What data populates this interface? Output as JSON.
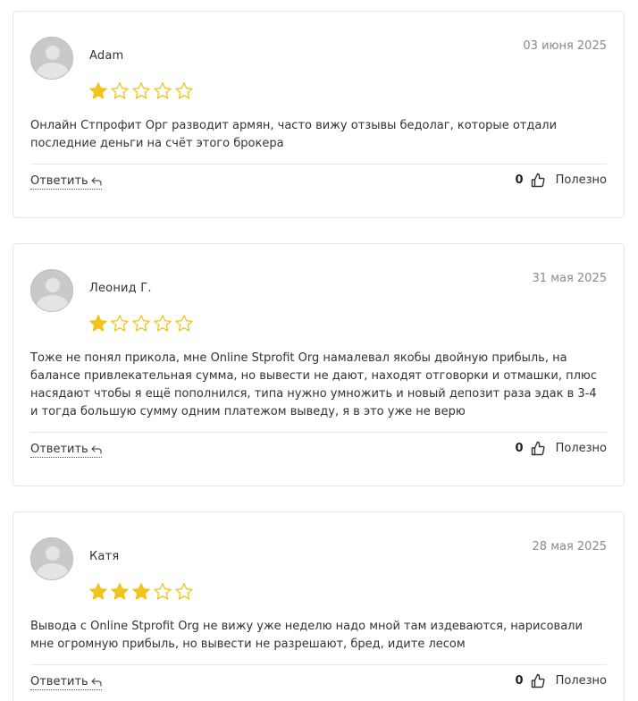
{
  "colors": {
    "star_filled": "#f2c31a",
    "star_empty_stroke": "#f2c31a",
    "border": "#e6e6e6",
    "date": "#8a8a8a"
  },
  "icons": {
    "avatar": "user-silhouette-icon",
    "star": "star-icon",
    "reply": "reply-arrow-icon",
    "helpful": "thumbs-up-icon"
  },
  "reviews": [
    {
      "author": "Adam",
      "date": "03 июня 2025",
      "rating": 1,
      "rating_max": 5,
      "text": "Онлайн Стпрофит Орг разводит армян, часто вижу отзывы бедолаг, которые отдали последние деньги на счёт этого брокера",
      "reply_label": "Ответить",
      "helpful_count": "0",
      "helpful_label": "Полезно"
    },
    {
      "author": "Леонид Г.",
      "date": "31 мая 2025",
      "rating": 1,
      "rating_max": 5,
      "text": "Тоже не понял прикола, мне Online Stprofit Org намалевал якобы двойную прибыль, на балансе привлекательная сумма, но вывести не дают, находят отговорки и отмашки, плюс насядают чтобы я ещё пополнился, типа нужно умножить и новый депозит раза эдак в 3-4 и тогда большую сумму одним платежом выведу, я в это уже не верю",
      "reply_label": "Ответить",
      "helpful_count": "0",
      "helpful_label": "Полезно"
    },
    {
      "author": "Катя",
      "date": "28 мая 2025",
      "rating": 3,
      "rating_max": 5,
      "text": "Вывода с Online Stprofit Org не вижу уже неделю надо мной там издеваются, нарисовали мне огромную прибыль, но вывести не разрешают, бред, идите лесом",
      "reply_label": "Ответить",
      "helpful_count": "0",
      "helpful_label": "Полезно"
    }
  ]
}
